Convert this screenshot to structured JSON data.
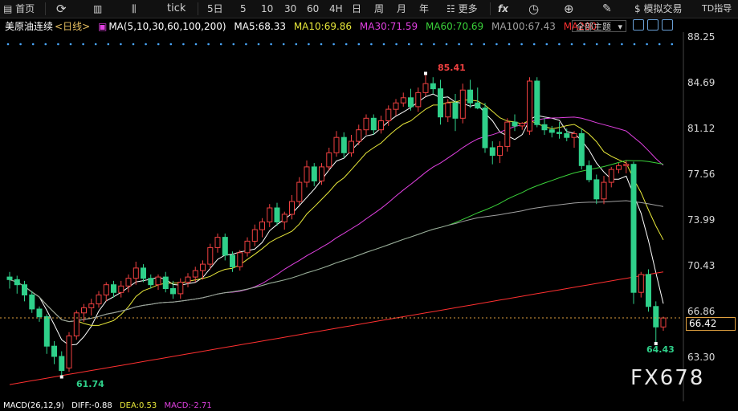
{
  "toolbar": {
    "home_label": "首页",
    "tick_label": "tick",
    "periods": [
      "5日",
      "5",
      "10",
      "30",
      "60",
      "4H",
      "日",
      "周",
      "月",
      "年"
    ],
    "more_label": "更多",
    "fx_label": "fx",
    "sim_trade_label": "模拟交易",
    "td_label": "TD指导"
  },
  "legend": {
    "instrument": "美原油连续",
    "period": "<日线>",
    "ma_params": "MA(5,10,30,60,100,200)",
    "ma5": "MA5:68.33",
    "ma10": "MA10:69.86",
    "ma30": "MA30:71.59",
    "ma60": "MA60:70.69",
    "ma100": "MA100:67.43",
    "ma200": "MA200"
  },
  "dropdown_label": "全部主题",
  "colors": {
    "up": "#ef4040",
    "down": "#2fd08a",
    "ma5": "#ffffff",
    "ma10": "#e8e83a",
    "ma30": "#e040e0",
    "ma60": "#3ad13a",
    "ma100": "#a0a0a0",
    "ma200": "#ff3030",
    "accent": "#e0a040",
    "dot": "#4aa8ff"
  },
  "price_axis": [
    "88.25",
    "84.69",
    "81.12",
    "77.56",
    "73.99",
    "70.43",
    "66.86",
    "63.30"
  ],
  "current_price": "66.42",
  "annotations": {
    "high": "85.41",
    "low": "61.74",
    "recent_low": "64.43"
  },
  "watermark": "FX678",
  "macd": {
    "title": "MACD(26,12,9)",
    "dif": "DIFF:-0.88",
    "dea": "DEA:0.53",
    "macd": "MACD:-2.71"
  },
  "chart_data": {
    "type": "candlestick",
    "y_range": [
      63.3,
      88.25
    ],
    "candles": [
      [
        69.5,
        69.9,
        68.6,
        69.3
      ],
      [
        69.3,
        69.6,
        68.2,
        68.9
      ],
      [
        68.9,
        69.2,
        67.6,
        68.1
      ],
      [
        68.1,
        68.4,
        66.7,
        67.0
      ],
      [
        67.0,
        67.2,
        66.0,
        66.4
      ],
      [
        66.4,
        66.6,
        63.5,
        64.1
      ],
      [
        64.1,
        64.5,
        62.7,
        63.3
      ],
      [
        63.3,
        63.7,
        61.7,
        62.2
      ],
      [
        62.4,
        65.2,
        62.1,
        64.9
      ],
      [
        64.9,
        66.9,
        64.6,
        66.7
      ],
      [
        66.7,
        67.4,
        66.0,
        67.1
      ],
      [
        67.1,
        67.8,
        66.5,
        67.4
      ],
      [
        67.4,
        68.4,
        67.1,
        68.1
      ],
      [
        68.1,
        69.1,
        67.6,
        68.9
      ],
      [
        68.9,
        69.2,
        67.9,
        68.3
      ],
      [
        68.3,
        69.2,
        67.9,
        68.8
      ],
      [
        68.8,
        69.7,
        68.3,
        69.4
      ],
      [
        69.4,
        70.7,
        68.9,
        70.2
      ],
      [
        70.2,
        70.5,
        69.1,
        69.4
      ],
      [
        69.4,
        69.7,
        68.6,
        68.9
      ],
      [
        68.9,
        69.7,
        68.5,
        69.5
      ],
      [
        69.5,
        69.9,
        68.3,
        68.6
      ],
      [
        68.6,
        69.2,
        67.8,
        68.2
      ],
      [
        68.2,
        69.4,
        67.8,
        69.1
      ],
      [
        69.1,
        69.8,
        68.7,
        69.5
      ],
      [
        69.5,
        70.3,
        69.1,
        70.0
      ],
      [
        70.0,
        70.8,
        69.3,
        70.5
      ],
      [
        70.5,
        72.1,
        70.1,
        71.8
      ],
      [
        71.8,
        72.9,
        71.4,
        72.6
      ],
      [
        72.6,
        72.9,
        70.8,
        71.2
      ],
      [
        71.2,
        71.5,
        69.9,
        70.3
      ],
      [
        70.3,
        71.6,
        70.0,
        71.4
      ],
      [
        71.4,
        72.6,
        71.1,
        72.3
      ],
      [
        72.3,
        73.6,
        71.9,
        73.2
      ],
      [
        73.2,
        74.1,
        72.6,
        73.8
      ],
      [
        73.8,
        75.2,
        73.4,
        74.9
      ],
      [
        74.9,
        75.3,
        73.5,
        73.8
      ],
      [
        73.8,
        74.6,
        73.2,
        74.4
      ],
      [
        74.4,
        75.9,
        74.0,
        75.4
      ],
      [
        75.4,
        77.3,
        75.1,
        76.9
      ],
      [
        76.9,
        78.6,
        76.5,
        78.1
      ],
      [
        78.1,
        78.4,
        76.6,
        77.0
      ],
      [
        77.0,
        78.4,
        76.7,
        78.1
      ],
      [
        78.1,
        79.6,
        77.8,
        79.2
      ],
      [
        79.2,
        80.9,
        78.9,
        80.4
      ],
      [
        80.4,
        80.8,
        78.8,
        79.2
      ],
      [
        79.2,
        80.6,
        78.9,
        80.1
      ],
      [
        80.1,
        81.4,
        79.8,
        81.0
      ],
      [
        81.0,
        82.2,
        80.6,
        81.9
      ],
      [
        81.9,
        82.2,
        80.6,
        81.0
      ],
      [
        81.0,
        82.1,
        80.7,
        81.7
      ],
      [
        81.7,
        82.9,
        81.3,
        82.6
      ],
      [
        82.6,
        83.4,
        82.1,
        83.1
      ],
      [
        83.1,
        83.9,
        82.8,
        83.5
      ],
      [
        83.5,
        84.2,
        82.5,
        82.8
      ],
      [
        82.8,
        84.3,
        82.4,
        83.9
      ],
      [
        83.9,
        85.4,
        83.6,
        84.6
      ],
      [
        84.6,
        85.1,
        83.8,
        84.2
      ],
      [
        84.2,
        84.9,
        81.4,
        82.0
      ],
      [
        82.0,
        83.4,
        81.6,
        83.1
      ],
      [
        83.1,
        83.8,
        80.9,
        81.9
      ],
      [
        81.9,
        84.6,
        81.5,
        84.1
      ],
      [
        84.1,
        84.9,
        82.7,
        83.1
      ],
      [
        83.1,
        84.3,
        82.6,
        82.7
      ],
      [
        82.7,
        83.1,
        79.2,
        79.6
      ],
      [
        79.6,
        80.1,
        78.3,
        79.0
      ],
      [
        79.0,
        80.1,
        78.4,
        79.7
      ],
      [
        79.7,
        81.9,
        79.3,
        81.6
      ],
      [
        81.6,
        82.2,
        80.9,
        81.3
      ],
      [
        81.3,
        81.6,
        81.0,
        81.5
      ],
      [
        80.9,
        85.1,
        80.6,
        84.8
      ],
      [
        84.8,
        85.1,
        81.2,
        81.4
      ],
      [
        81.4,
        81.9,
        80.6,
        81.0
      ],
      [
        81.0,
        81.3,
        80.4,
        80.8
      ],
      [
        80.8,
        81.6,
        80.3,
        80.7
      ],
      [
        80.7,
        81.1,
        80.1,
        80.4
      ],
      [
        80.4,
        80.9,
        79.6,
        80.7
      ],
      [
        80.7,
        81.1,
        77.9,
        78.2
      ],
      [
        78.2,
        78.6,
        76.9,
        77.1
      ],
      [
        77.1,
        77.5,
        75.2,
        75.6
      ],
      [
        75.6,
        77.4,
        75.2,
        76.9
      ],
      [
        76.9,
        78.1,
        76.5,
        77.9
      ],
      [
        77.9,
        78.4,
        77.6,
        78.2
      ],
      [
        78.2,
        78.6,
        77.6,
        78.3
      ],
      [
        78.3,
        78.5,
        67.4,
        68.3
      ],
      [
        68.3,
        69.9,
        67.9,
        69.7
      ],
      [
        69.7,
        70.1,
        66.8,
        67.2
      ],
      [
        67.2,
        67.6,
        64.3,
        65.6
      ],
      [
        65.6,
        66.4,
        65.3,
        66.3
      ]
    ],
    "marked": {
      "high_index": 56,
      "low_index": 7,
      "recent_low_index": 87
    }
  }
}
